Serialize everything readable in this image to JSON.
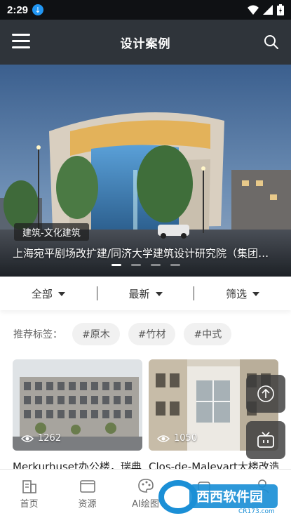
{
  "status": {
    "time": "2:29"
  },
  "header": {
    "title": "设计案例"
  },
  "banner": {
    "tag": "建筑-文化建筑",
    "caption": "上海宛平剧场改扩建/同济大学建筑设计研究院（集团）有限公司",
    "dots": 4,
    "active_dot": 0
  },
  "filters": {
    "all": "全部",
    "latest": "最新",
    "filter": "筛选"
  },
  "tags": {
    "label": "推荐标签：",
    "items": [
      "#原木",
      "#竹材",
      "#中式"
    ]
  },
  "cards": [
    {
      "views": "1262",
      "title": "Merkurhuset办公楼，瑞典"
    },
    {
      "views": "1050",
      "title": "Clos-de-Malevart大楼改造"
    }
  ],
  "tabbar": {
    "home": "首页",
    "resources": "资源",
    "ai": "AI绘图"
  },
  "watermark": {
    "brand": "西西软件园",
    "site": "CR173.com"
  },
  "colors": {
    "header_bg": "#2f343a",
    "status_bg": "#0f1114",
    "accent": "#2196f3"
  }
}
